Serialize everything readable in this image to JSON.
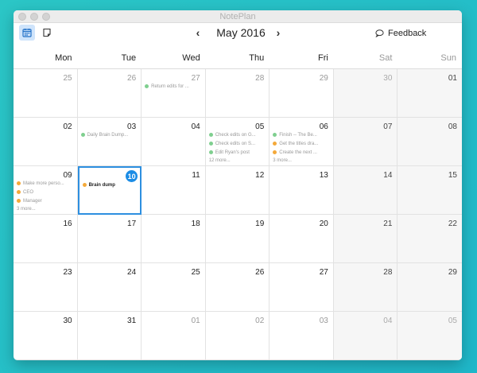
{
  "window": {
    "title": "NotePlan"
  },
  "toolbar": {
    "month_title": "May 2016",
    "prev_icon": "‹",
    "next_icon": "›",
    "feedback_label": "Feedback"
  },
  "weekdays": [
    "Mon",
    "Tue",
    "Wed",
    "Thu",
    "Fri",
    "Sat",
    "Sun"
  ],
  "colors": {
    "green": "#7fcf8f",
    "orange": "#f4a93a",
    "accent": "#1b8ce5"
  },
  "days": [
    {
      "num": "25",
      "other": true,
      "events": []
    },
    {
      "num": "26",
      "other": true,
      "events": []
    },
    {
      "num": "27",
      "other": true,
      "events": [
        {
          "text": "Return edits for ...",
          "color": "green"
        }
      ]
    },
    {
      "num": "28",
      "other": true,
      "events": []
    },
    {
      "num": "29",
      "other": true,
      "events": []
    },
    {
      "num": "30",
      "other": true,
      "events": []
    },
    {
      "num": "01",
      "other": false,
      "events": []
    },
    {
      "num": "02",
      "other": false,
      "events": []
    },
    {
      "num": "03",
      "other": false,
      "events": [
        {
          "text": "Daily Brain Dump...",
          "color": "green"
        }
      ]
    },
    {
      "num": "04",
      "other": false,
      "events": []
    },
    {
      "num": "05",
      "other": false,
      "events": [
        {
          "text": "Check edits on G...",
          "color": "green"
        },
        {
          "text": "Check edits on S...",
          "color": "green"
        },
        {
          "text": "Edit Ryan's post",
          "color": "green"
        }
      ],
      "more": "12 more..."
    },
    {
      "num": "06",
      "other": false,
      "events": [
        {
          "text": "Finish -- The Be...",
          "color": "green"
        },
        {
          "text": "Get the titles dra...",
          "color": "orange"
        },
        {
          "text": "Create the next ...",
          "color": "orange"
        }
      ],
      "more": "3 more..."
    },
    {
      "num": "07",
      "other": false,
      "events": []
    },
    {
      "num": "08",
      "other": false,
      "events": []
    },
    {
      "num": "09",
      "other": false,
      "events": [
        {
          "text": "Make more perso...",
          "color": "orange"
        },
        {
          "text": "CEO",
          "color": "orange"
        },
        {
          "text": "Manager",
          "color": "orange"
        }
      ],
      "more": "3 more..."
    },
    {
      "num": "10",
      "other": false,
      "today": true,
      "events": [
        {
          "text": "Brain dump",
          "color": "orange",
          "dark": true
        }
      ]
    },
    {
      "num": "11",
      "other": false,
      "events": []
    },
    {
      "num": "12",
      "other": false,
      "events": []
    },
    {
      "num": "13",
      "other": false,
      "events": []
    },
    {
      "num": "14",
      "other": false,
      "events": []
    },
    {
      "num": "15",
      "other": false,
      "events": []
    },
    {
      "num": "16",
      "other": false,
      "events": []
    },
    {
      "num": "17",
      "other": false,
      "events": []
    },
    {
      "num": "18",
      "other": false,
      "events": []
    },
    {
      "num": "19",
      "other": false,
      "events": []
    },
    {
      "num": "20",
      "other": false,
      "events": []
    },
    {
      "num": "21",
      "other": false,
      "events": []
    },
    {
      "num": "22",
      "other": false,
      "events": []
    },
    {
      "num": "23",
      "other": false,
      "events": []
    },
    {
      "num": "24",
      "other": false,
      "events": []
    },
    {
      "num": "25",
      "other": false,
      "events": []
    },
    {
      "num": "26",
      "other": false,
      "events": []
    },
    {
      "num": "27",
      "other": false,
      "events": []
    },
    {
      "num": "28",
      "other": false,
      "events": []
    },
    {
      "num": "29",
      "other": false,
      "events": []
    },
    {
      "num": "30",
      "other": false,
      "events": []
    },
    {
      "num": "31",
      "other": false,
      "events": []
    },
    {
      "num": "01",
      "other": true,
      "events": []
    },
    {
      "num": "02",
      "other": true,
      "events": []
    },
    {
      "num": "03",
      "other": true,
      "events": []
    },
    {
      "num": "04",
      "other": true,
      "events": []
    },
    {
      "num": "05",
      "other": true,
      "events": []
    }
  ]
}
